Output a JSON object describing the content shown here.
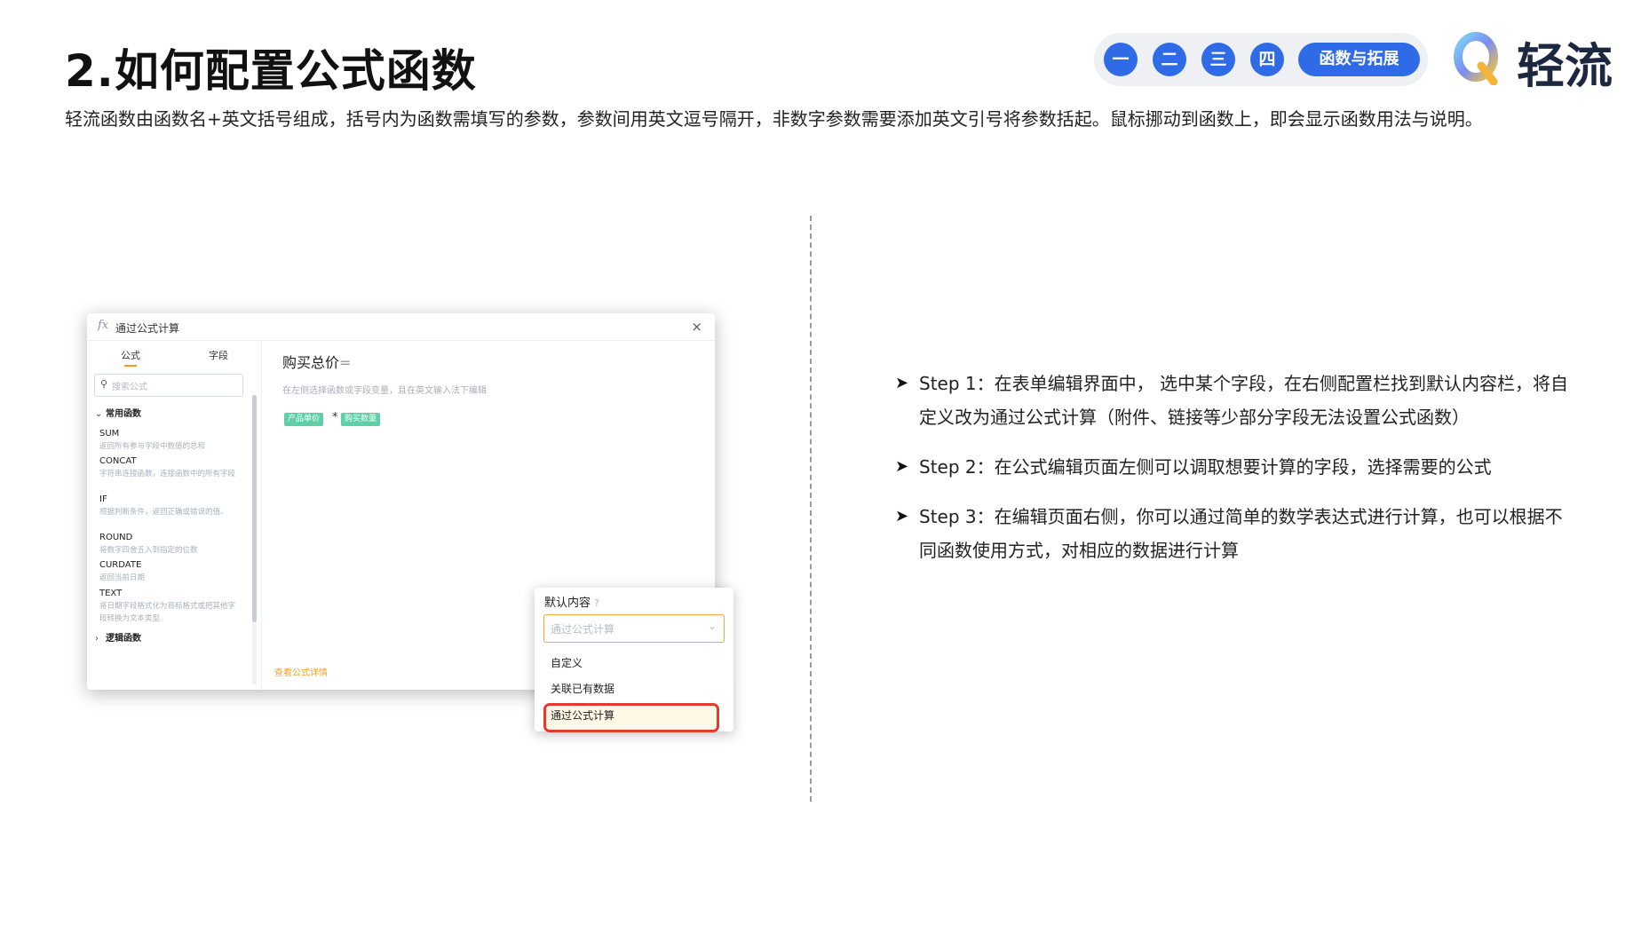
{
  "header": {
    "title": "2.如何配置公式函数",
    "description": "轻流函数由函数名+英文括号组成，括号内为函数需填写的参数，参数间用英文逗号隔开，非数字参数需要添加英文引号将参数括起。鼠标挪动到函数上，即会显示函数用法与说明。"
  },
  "nav": {
    "items": [
      "一",
      "二",
      "三",
      "四"
    ],
    "active_label": "函数与拓展",
    "accent_color": "#2f6be6"
  },
  "brand": {
    "name": "轻流"
  },
  "dialog": {
    "title": "通过公式计算",
    "fx_symbol": "fx",
    "close_symbol": "×",
    "tabs": [
      "公式",
      "字段"
    ],
    "search_placeholder": "搜索公式",
    "category_common": "常用函数",
    "category_logic": "逻辑函数",
    "functions": [
      {
        "name": "SUM",
        "desc": "返回所有参与字段中数值的总和"
      },
      {
        "name": "CONCAT",
        "desc": "字符串连接函数，连接函数中的所有字段"
      },
      {
        "name": "IF",
        "desc": "根据判断条件，返回正确或错误的值。"
      },
      {
        "name": "ROUND",
        "desc": "将数字四舍五入到指定的位数"
      },
      {
        "name": "CURDATE",
        "desc": "返回当前日期"
      },
      {
        "name": "TEXT",
        "desc": "将日期字段格式化为目标格式或把其他字段转换为文本类型"
      }
    ],
    "formula_field": "购买总价",
    "formula_eq": "=",
    "hint": "在左侧选择函数或字段变量，且在英文输入法下编辑",
    "tag1": "产品单价",
    "operator": "*",
    "tag2": "购买数量",
    "detail_link": "查看公式详情"
  },
  "dropdown": {
    "label": "默认内容",
    "help_icon": "?",
    "selected_placeholder": "通过公式计算",
    "options": [
      "自定义",
      "关联已有数据",
      "通过公式计算"
    ],
    "highlight_color": "#e23b2e"
  },
  "steps": [
    {
      "label": "Step 1：",
      "text": "在表单编辑界面中， 选中某个字段，在右侧配置栏找到默认内容栏，将自定义改为通过公式计算（附件、链接等少部分字段无法设置公式函数）"
    },
    {
      "label": "Step 2：",
      "text": "在公式编辑页面左侧可以调取想要计算的字段，选择需要的公式"
    },
    {
      "label": "Step 3：",
      "text": "在编辑页面右侧，你可以通过简单的数学表达式进行计算，也可以根据不同函数使用方式，对相应的数据进行计算"
    }
  ]
}
